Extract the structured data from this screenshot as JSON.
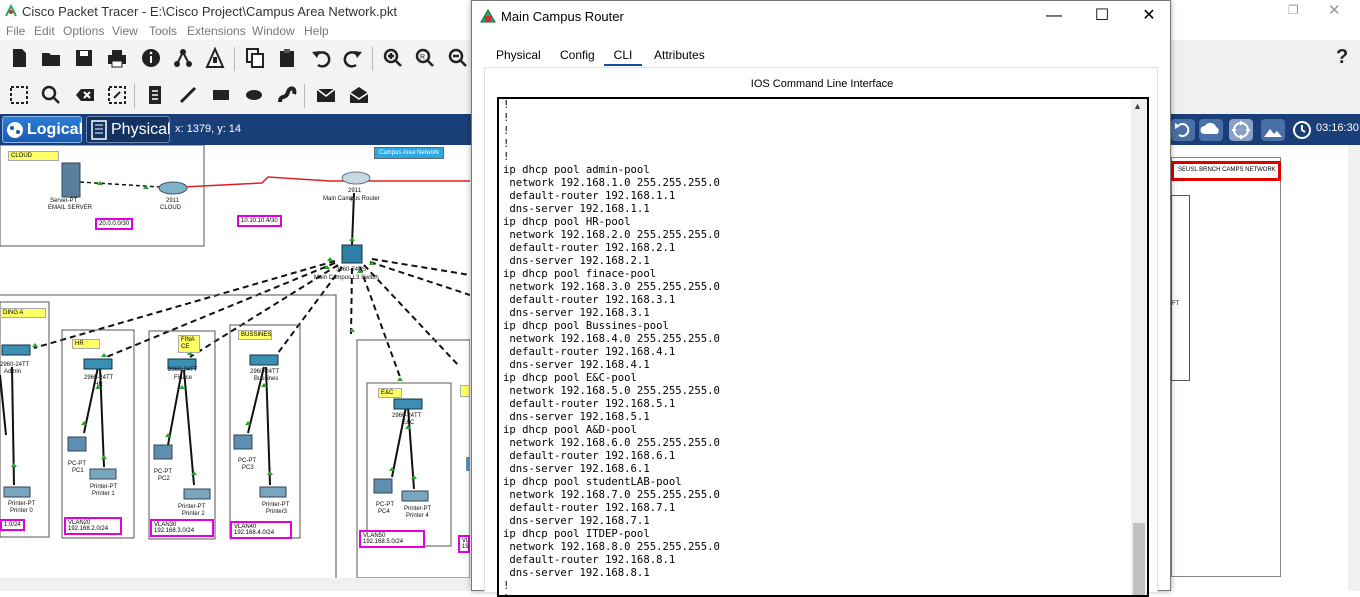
{
  "app": {
    "title": "Cisco Packet Tracer - E:\\Cisco Project\\Campus Area Network.pkt",
    "menu": [
      "File",
      "Edit",
      "Options",
      "View",
      "Tools",
      "Extensions",
      "Window",
      "Help"
    ],
    "help_label": "?",
    "mode_tabs": {
      "logical": "Logical",
      "physical": "Physical"
    },
    "coords": "x: 1379, y: 14",
    "clock": "03:16:30"
  },
  "topology": {
    "cloud_tag": "CLOUD",
    "area_network_label": "Campus Area Network",
    "email_server": [
      "Server-PT",
      "EMAIL SERVER"
    ],
    "cloud_router": [
      "2911",
      "CLOUD"
    ],
    "cloud_net": "20.0.0.0/30",
    "wan_link": "10.10.10.4/30",
    "main_router": [
      "2911",
      "Main Campus Router"
    ],
    "main_switch": [
      "3560-24PS",
      "Main Campus L3 Switch"
    ],
    "branch_label": "SEUSL BRNCH CAMPS NETWORK",
    "branch_device": "FT",
    "buildings": [
      {
        "tag": "DING A",
        "switch": [
          "2960-24TT",
          "Admin"
        ],
        "devices": [
          [
            "Printer-PT",
            "Printer 0"
          ]
        ],
        "vlan": [
          "",
          "1.0/24"
        ]
      },
      {
        "tag": "HR",
        "switch": [
          "2960-24TT",
          "HR"
        ],
        "devices": [
          [
            "PC-PT",
            "PC1"
          ],
          [
            "Printer-PT",
            "Printer 1"
          ]
        ],
        "vlan": [
          "VLAN20",
          "192.168.2.0/24"
        ]
      },
      {
        "tag": "FINA CE",
        "switch": [
          "2960-24TT",
          "Finace"
        ],
        "devices": [
          [
            "PC-PT",
            "PC2"
          ],
          [
            "Printer-PT",
            "Printer 2"
          ]
        ],
        "vlan": [
          "VLAN30",
          "192.168.3.0/24"
        ]
      },
      {
        "tag": "BUSSINES",
        "switch": [
          "2960-24TT",
          "Bussines"
        ],
        "devices": [
          [
            "PC-PT",
            "PC3"
          ],
          [
            "Printer-PT",
            "Printer3"
          ]
        ],
        "vlan": [
          "VLAN40",
          "192.168.4.0/24"
        ]
      },
      {
        "tag": "E&C",
        "switch": [
          "2960-24TT",
          "E&C"
        ],
        "devices": [
          [
            "PC-PT",
            "PC4"
          ],
          [
            "Printer-PT",
            "Printer 4"
          ]
        ],
        "vlan": [
          "VLAN50",
          "192.168.5.0/24"
        ]
      }
    ],
    "partial_vlan": [
      "VL",
      "19"
    ]
  },
  "dialog": {
    "title": "Main Campus Router",
    "controls": {
      "minimize": "—",
      "maximize": "☐",
      "close": "✕"
    },
    "tabs": [
      "Physical",
      "Config",
      "CLI",
      "Attributes"
    ],
    "active_tab": "CLI",
    "heading": "IOS Command Line Interface",
    "cli_lines": [
      "!",
      "!",
      "!",
      "!",
      "!",
      "ip dhcp pool admin-pool",
      " network 192.168.1.0 255.255.255.0",
      " default-router 192.168.1.1",
      " dns-server 192.168.1.1",
      "ip dhcp pool HR-pool",
      " network 192.168.2.0 255.255.255.0",
      " default-router 192.168.2.1",
      " dns-server 192.168.2.1",
      "ip dhcp pool finace-pool",
      " network 192.168.3.0 255.255.255.0",
      " default-router 192.168.3.1",
      " dns-server 192.168.3.1",
      "ip dhcp pool Bussines-pool",
      " network 192.168.4.0 255.255.255.0",
      " default-router 192.168.4.1",
      " dns-server 192.168.4.1",
      "ip dhcp pool E&C-pool",
      " network 192.168.5.0 255.255.255.0",
      " default-router 192.168.5.1",
      " dns-server 192.168.5.1",
      "ip dhcp pool A&D-pool",
      " network 192.168.6.0 255.255.255.0",
      " default-router 192.168.6.1",
      " dns-server 192.168.6.1",
      "ip dhcp pool studentLAB-pool",
      " network 192.168.7.0 255.255.255.0",
      " default-router 192.168.7.1",
      " dns-server 192.168.7.1",
      "ip dhcp pool ITDEP-pool",
      " network 192.168.8.0 255.255.255.0",
      " default-router 192.168.8.1",
      " dns-server 192.168.8.1",
      "!",
      "!"
    ]
  }
}
